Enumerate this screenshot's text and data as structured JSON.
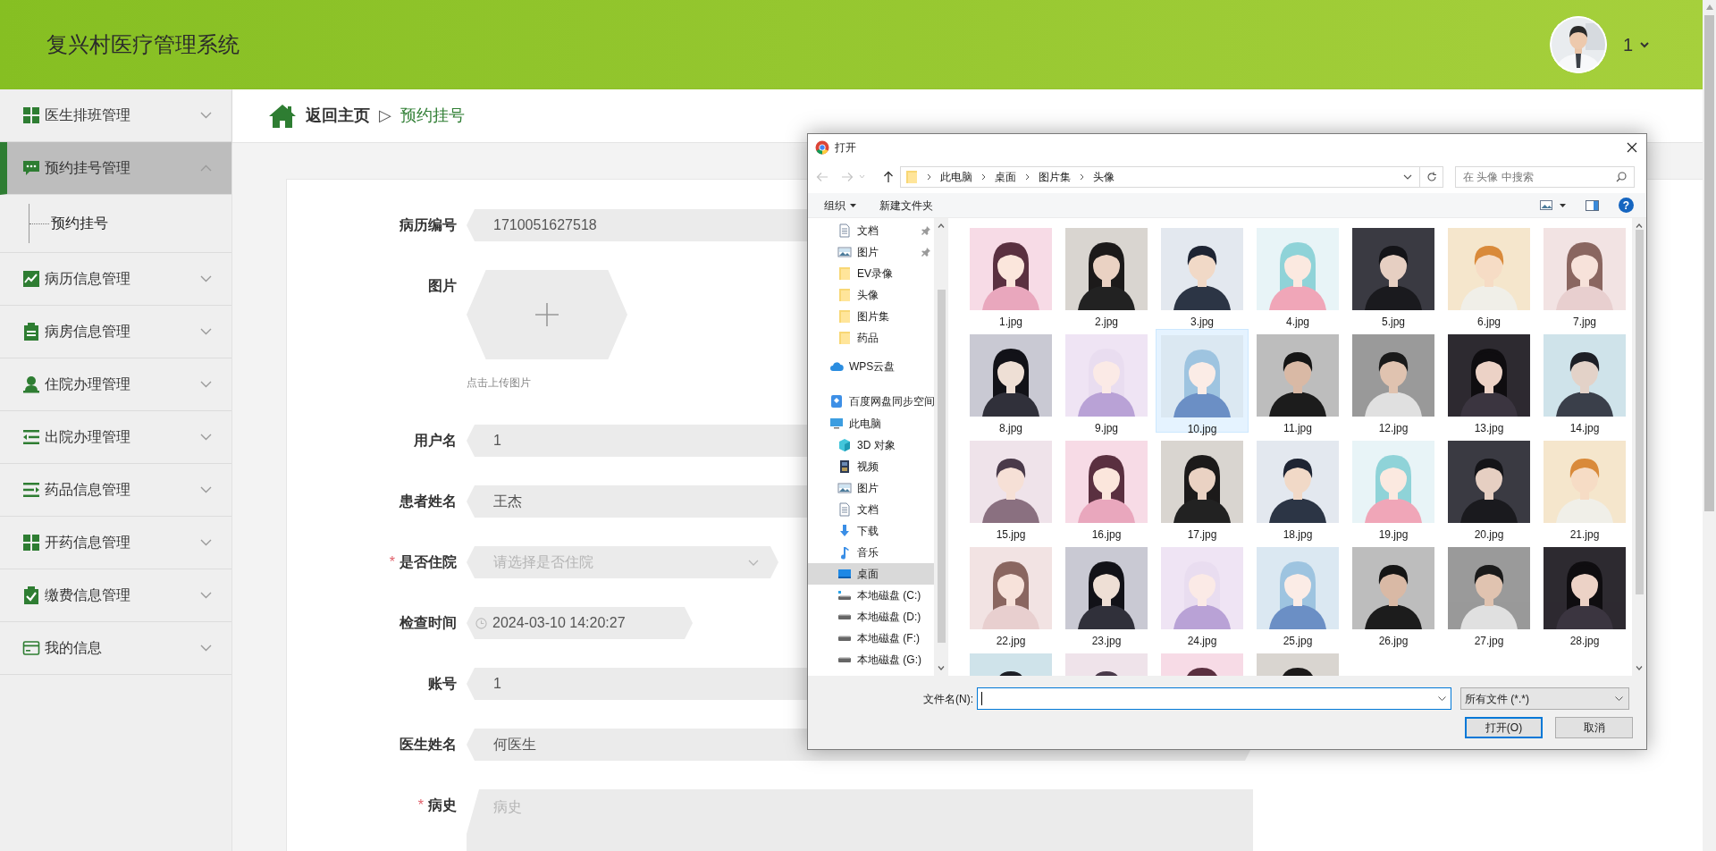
{
  "header": {
    "title": "复兴村医疗管理系统",
    "user": "1"
  },
  "sidebar": {
    "items": [
      {
        "label": "医生排班管理",
        "selected": false,
        "expanded": false
      },
      {
        "label": "预约挂号管理",
        "selected": true,
        "expanded": true,
        "children": [
          {
            "label": "预约挂号",
            "selected": false
          }
        ]
      },
      {
        "label": "病历信息管理",
        "selected": false,
        "expanded": false
      },
      {
        "label": "病房信息管理",
        "selected": false,
        "expanded": false
      },
      {
        "label": "住院办理管理",
        "selected": false,
        "expanded": false
      },
      {
        "label": "出院办理管理",
        "selected": false,
        "expanded": false
      },
      {
        "label": "药品信息管理",
        "selected": false,
        "expanded": false
      },
      {
        "label": "开药信息管理",
        "selected": false,
        "expanded": false
      },
      {
        "label": "缴费信息管理",
        "selected": false,
        "expanded": false
      },
      {
        "label": "我的信息",
        "selected": false,
        "expanded": false
      }
    ]
  },
  "breadcrumb": {
    "home": "返回主页",
    "separator": "▷",
    "current": "预约挂号"
  },
  "form": {
    "fields": [
      {
        "kind": "text",
        "label": "病历编号",
        "value": "1710051627518"
      },
      {
        "kind": "upload",
        "label": "图片",
        "hint": "点击上传图片"
      },
      {
        "kind": "text",
        "label": "用户名",
        "value": "1"
      },
      {
        "kind": "text",
        "label": "患者姓名",
        "value": "王杰"
      },
      {
        "kind": "select",
        "label": "是否住院",
        "required_mark": "*",
        "placeholder": "请选择是否住院"
      },
      {
        "kind": "datetime",
        "label": "检查时间",
        "value": "2024-03-10 14:20:27"
      },
      {
        "kind": "text",
        "label": "账号",
        "value": "1"
      },
      {
        "kind": "text",
        "label": "医生姓名",
        "value": "何医生"
      },
      {
        "kind": "textarea",
        "label": "病史",
        "required_mark": "*",
        "placeholder": "病史"
      }
    ]
  },
  "dialog": {
    "title": "打开",
    "path": [
      "此电脑",
      "桌面",
      "图片集",
      "头像"
    ],
    "search": {
      "placeholder": "在 头像 中搜索"
    },
    "toolbar": {
      "organize": "组织",
      "new_folder": "新建文件夹",
      "help": "?"
    },
    "nav": {
      "quick_access": [
        {
          "label": "文档",
          "pinned": true,
          "selected": false
        },
        {
          "label": "图片",
          "pinned": true,
          "selected": false
        },
        {
          "label": "EV录像",
          "pinned": false,
          "selected": false
        },
        {
          "label": "头像",
          "pinned": false,
          "selected": false
        },
        {
          "label": "图片集",
          "pinned": false,
          "selected": false
        },
        {
          "label": "药品",
          "pinned": false,
          "selected": false
        }
      ],
      "roots": [
        {
          "label": "WPS云盘",
          "selected": false
        },
        {
          "label": "百度网盘同步空间",
          "selected": false
        },
        {
          "label": "此电脑",
          "selected": false,
          "children": [
            {
              "label": "3D 对象",
              "selected": false
            },
            {
              "label": "视频",
              "selected": false
            },
            {
              "label": "图片",
              "selected": false
            },
            {
              "label": "文档",
              "selected": false
            },
            {
              "label": "下载",
              "selected": false
            },
            {
              "label": "音乐",
              "selected": false
            },
            {
              "label": "桌面",
              "selected": true
            },
            {
              "label": "本地磁盘 (C:)",
              "selected": false
            },
            {
              "label": "本地磁盘 (D:)",
              "selected": false
            },
            {
              "label": "本地磁盘 (F:)",
              "selected": false
            },
            {
              "label": "本地磁盘 (G:)",
              "selected": false
            }
          ]
        }
      ]
    },
    "files": [
      {
        "name": "1.jpg",
        "highlighted": false
      },
      {
        "name": "2.jpg",
        "highlighted": false
      },
      {
        "name": "3.jpg",
        "highlighted": false
      },
      {
        "name": "4.jpg",
        "highlighted": false
      },
      {
        "name": "5.jpg",
        "highlighted": false
      },
      {
        "name": "6.jpg",
        "highlighted": false
      },
      {
        "name": "7.jpg",
        "highlighted": false
      },
      {
        "name": "8.jpg",
        "highlighted": false
      },
      {
        "name": "9.jpg",
        "highlighted": false
      },
      {
        "name": "10.jpg",
        "highlighted": true
      },
      {
        "name": "11.jpg",
        "highlighted": false
      },
      {
        "name": "12.jpg",
        "highlighted": false
      },
      {
        "name": "13.jpg",
        "highlighted": false
      },
      {
        "name": "14.jpg",
        "highlighted": false
      },
      {
        "name": "15.jpg",
        "highlighted": false
      },
      {
        "name": "16.jpg",
        "highlighted": false
      },
      {
        "name": "17.jpg",
        "highlighted": false
      },
      {
        "name": "18.jpg",
        "highlighted": false
      },
      {
        "name": "19.jpg",
        "highlighted": false
      },
      {
        "name": "20.jpg",
        "highlighted": false
      },
      {
        "name": "21.jpg",
        "highlighted": false
      },
      {
        "name": "22.jpg",
        "highlighted": false
      },
      {
        "name": "23.jpg",
        "highlighted": false
      },
      {
        "name": "24.jpg",
        "highlighted": false
      },
      {
        "name": "25.jpg",
        "highlighted": false
      },
      {
        "name": "26.jpg",
        "highlighted": false
      },
      {
        "name": "27.jpg",
        "highlighted": false
      },
      {
        "name": "28.jpg",
        "highlighted": false
      },
      {
        "highlighted": false
      },
      {
        "highlighted": false
      },
      {
        "highlighted": false
      },
      {
        "highlighted": false
      }
    ],
    "filename_label": "文件名(N):",
    "filetype": "所有文件 (*.*)",
    "buttons": [
      {
        "label": "打开(O)",
        "kind": "primary"
      },
      {
        "label": "取消",
        "kind": "normal"
      }
    ]
  }
}
